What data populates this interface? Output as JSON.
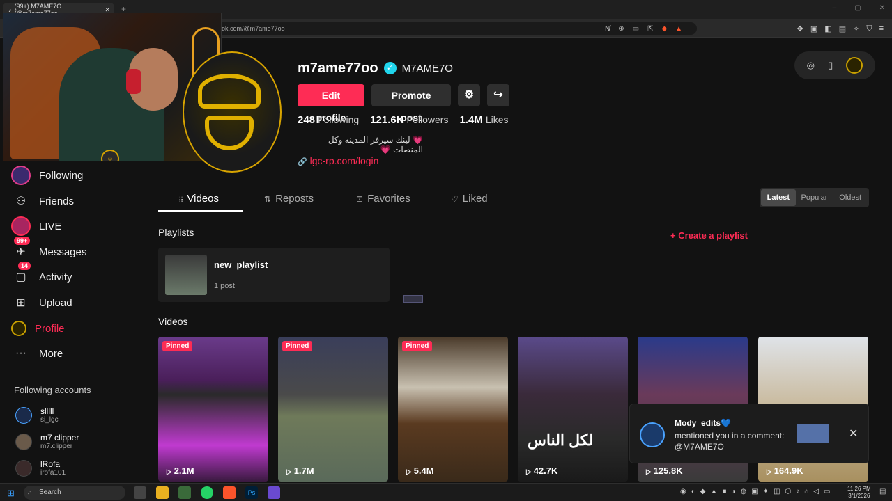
{
  "browser": {
    "tab_title": "(99+) M7AME7O (@m7ame77oo",
    "tab_close": "✕",
    "new_tab": "+",
    "url": "ok.com/@m7ame77oo",
    "win_min": "–",
    "win_max": "▢",
    "win_close": "✕"
  },
  "profile": {
    "username": "m7ame77oo",
    "verified_mark": "✓",
    "nickname": "M7AME7O",
    "edit_profile": "Edit profile",
    "promote_post": "Promote post",
    "settings_icon": "⚙",
    "share_icon": "↪",
    "stats": [
      {
        "value": "248",
        "label": "Following"
      },
      {
        "value": "121.6K",
        "label": "Followers"
      },
      {
        "value": "1.4M",
        "label": "Likes"
      }
    ],
    "bio": "💗 لينك سيرفر المدينه وكل المنصات 💗",
    "link": "lgc-rp.com/login",
    "link_icon": "🔗"
  },
  "sidebar": {
    "items": [
      {
        "label": "Following",
        "icon": "avatar"
      },
      {
        "label": "Friends",
        "icon": "friends-icon"
      },
      {
        "label": "LIVE",
        "icon": "live-icon"
      },
      {
        "label": "Messages",
        "icon": "messages-icon",
        "badge": "99+"
      },
      {
        "label": "Activity",
        "icon": "activity-icon",
        "badge": "14"
      },
      {
        "label": "Upload",
        "icon": "upload-icon"
      },
      {
        "label": "Profile",
        "icon": "profile-avatar"
      },
      {
        "label": "More",
        "icon": "more-icon"
      }
    ],
    "following_accounts_title": "Following accounts",
    "accounts": [
      {
        "name": "slllll",
        "handle": "si_lgc"
      },
      {
        "name": "m7 clipper",
        "handle": "m7.clipper"
      },
      {
        "name": "lRofa",
        "handle": "irofa101"
      }
    ]
  },
  "tabs": [
    {
      "label": "Videos",
      "icon": "⦙⦙"
    },
    {
      "label": "Reposts",
      "icon": "⇅"
    },
    {
      "label": "Favorites",
      "icon": "⊡"
    },
    {
      "label": "Liked",
      "icon": "♡"
    }
  ],
  "sort": {
    "latest": "Latest",
    "popular": "Popular",
    "oldest": "Oldest"
  },
  "playlists": {
    "title": "Playlists",
    "create": "+ Create a playlist",
    "item_name": "new_playlist",
    "item_count": "1 post"
  },
  "videos": {
    "title": "Videos",
    "pinned_label": "Pinned",
    "cards": [
      {
        "views": "2.1M",
        "pinned": true,
        "bg": "linear-gradient(180deg,#6a3b8a 0%,#4a1f5a 30%,#2a2a2a 40%,#c03ad0 75%,#3a1a40 100%)"
      },
      {
        "views": "1.7M",
        "pinned": true,
        "bg": "linear-gradient(180deg,#3a3e5a 0%,#4a4a4a 40%,#6f7a5a 55%,#5a6a5a 100%)"
      },
      {
        "views": "5.4M",
        "pinned": true,
        "bg": "linear-gradient(180deg,#4a3a2a 0%,#c8c0b0 35%,#5a3a20 60%,#3a2a1a 100%)"
      },
      {
        "views": "42.7K",
        "pinned": false,
        "caption": "لكل الناس",
        "bg": "linear-gradient(180deg,#5a4a8a 0%,#3a2a3a 40%,#2a2a2a 70%,#1a1a1a 100%)"
      },
      {
        "views": "125.8K",
        "pinned": false,
        "bg": "linear-gradient(180deg,#2a3a8a 0%,#6a3a5a 40%,#3a3a3a 100%)"
      },
      {
        "views": "164.9K",
        "pinned": false,
        "bg": "linear-gradient(180deg,#dfe3e8 0%,#c8b89a 50%,#a89060 100%)"
      }
    ],
    "play_icon": "▷"
  },
  "notification": {
    "name": "Mody_edits💙",
    "message": "mentioned you in a comment: @M7AME7O",
    "close": "✕"
  },
  "taskbar": {
    "search": "Search",
    "time": "11:26 PM",
    "date": "3/1/2026"
  }
}
